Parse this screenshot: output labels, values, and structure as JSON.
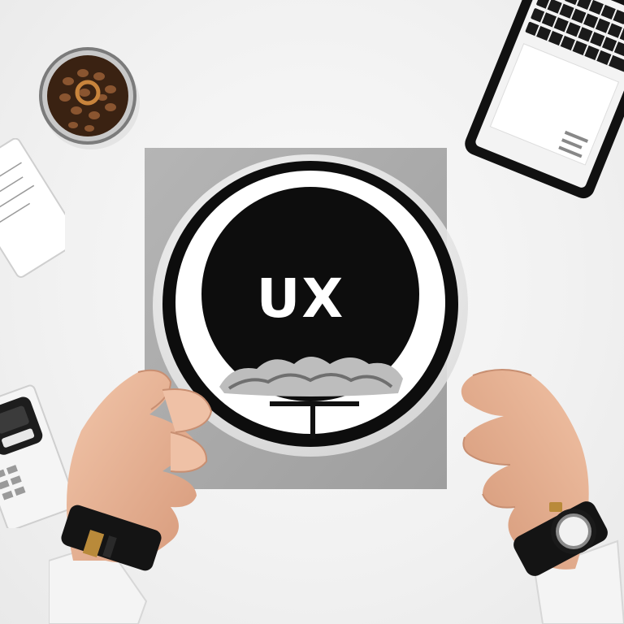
{
  "scene": {
    "description_colors": {
      "desk": "#f2f2f2",
      "board": "#a9a9a9",
      "sign_black": "#0d0d0d",
      "sign_white": "#ffffff",
      "skin": "#e9b79a",
      "watch_black": "#141414",
      "watch_gold": "#b98a3a",
      "coffee": "#5a341c"
    },
    "sign": {
      "text": "UX"
    },
    "objects": {
      "tablet": "tablet-with-keyboard",
      "coffee_tin": "coffee-bean-tin",
      "notebook": "notebook",
      "calculator": "calculator",
      "left_watch": "wristwatch",
      "right_watch": "smartwatch"
    }
  }
}
